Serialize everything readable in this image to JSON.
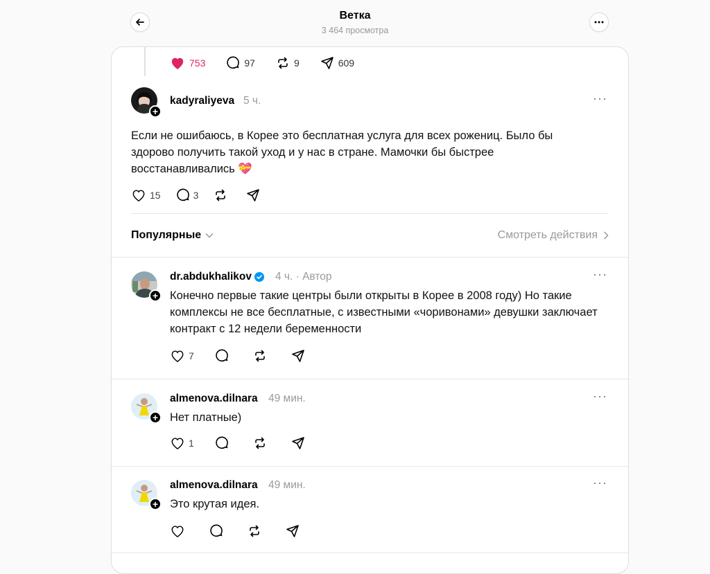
{
  "header": {
    "title": "Ветка",
    "views": "3 464 просмотра",
    "back_icon": "arrow-left-icon",
    "more_icon": "ellipsis-icon"
  },
  "parent_stats": {
    "likes": "753",
    "replies": "97",
    "reposts": "9",
    "shares": "609"
  },
  "main_reply": {
    "username": "kadyraliyeva",
    "time": "5 ч.",
    "text": "Если не ошибаюсь, в Корее это бесплатная услуга для всех рожениц. Было бы здорово получить такой уход и у нас в стране. Мамочки бы быстрее восстанавливались",
    "emoji": "💝",
    "likes": "15",
    "replies": "3"
  },
  "sort": {
    "label": "Популярные",
    "view_actions": "Смотреть действия"
  },
  "comments": [
    {
      "username": "dr.abdukhalikov",
      "time": "4 ч.",
      "tag": "Автор",
      "text": "Конечно первые такие центры были открыты в Корее в 2008 году) Но такие комплексы не все бесплатные, с известными «чоривонами» девушки заключает контракт с 12 недели беременности",
      "likes": "7"
    },
    {
      "username": "almenova.dilnara",
      "time": "49 мин.",
      "text": "Нет платные)",
      "likes": "1"
    },
    {
      "username": "almenova.dilnara",
      "time": "49 мин.",
      "text": "Это крутая идея.",
      "likes": ""
    }
  ],
  "colors": {
    "like_red": "#e0245e",
    "verified_blue": "#0095f6",
    "muted": "#999999"
  }
}
